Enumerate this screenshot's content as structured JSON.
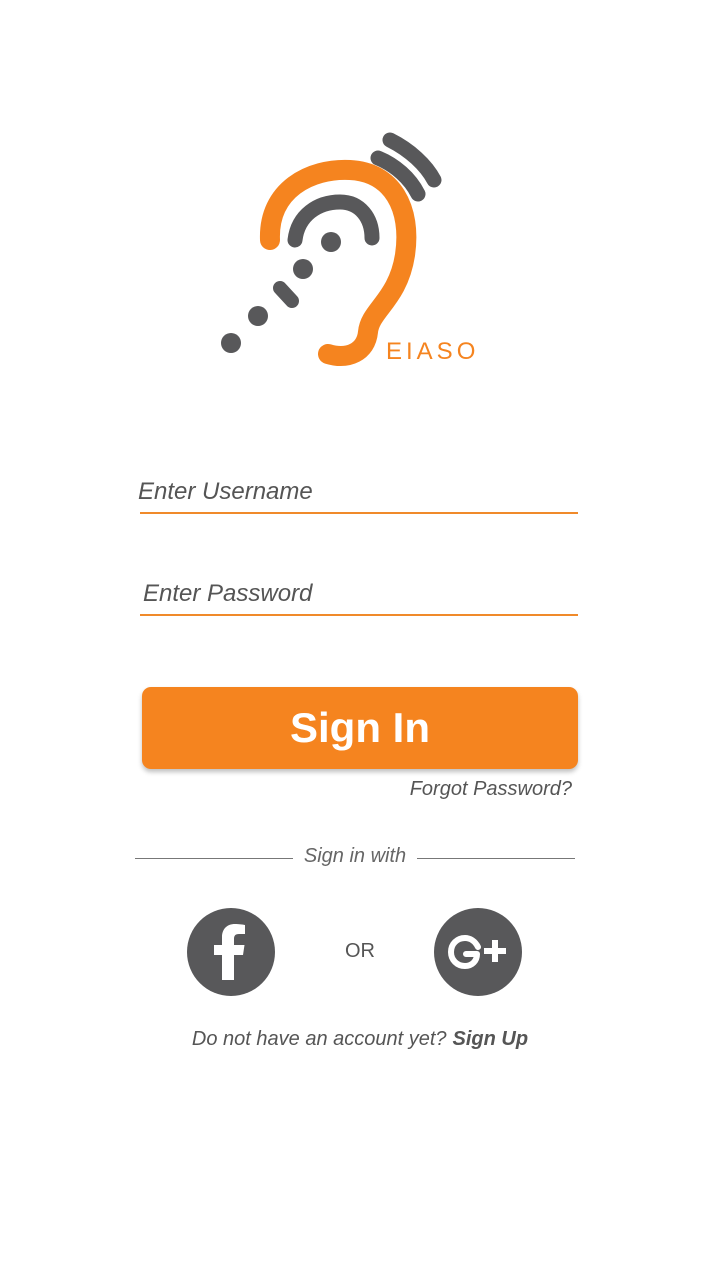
{
  "brand": {
    "name": "EIASO",
    "accent_color": "#F5841F",
    "icon_color": "#58585A",
    "logo_icon": "ear-hearing-icon"
  },
  "form": {
    "username_placeholder": "Enter Username",
    "password_placeholder": "Enter Password",
    "signin_label": "Sign In",
    "forgot_label": "Forgot Password?"
  },
  "social": {
    "divider_label": "Sign in with",
    "facebook_icon": "facebook-icon",
    "google_icon": "google-plus-icon",
    "or_label": "OR"
  },
  "footer": {
    "prompt": "Do not have an account yet?",
    "signup_label": "Sign Up"
  }
}
